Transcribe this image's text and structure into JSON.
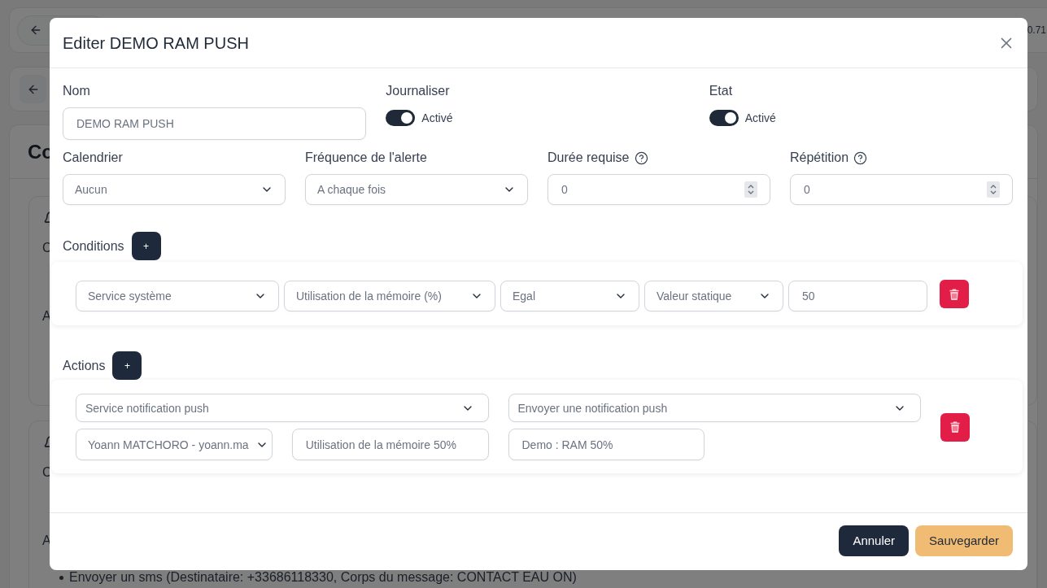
{
  "background": {
    "version": "0.71",
    "section_title": "Co",
    "cards": [
      {
        "lines": [
          "C",
          "A"
        ]
      },
      {
        "lines": [
          "C",
          "A"
        ],
        "bullets": [
          "Envoyer un sms (Destinataire: +33686118330, Corps du message: CONTACT EAU ON)"
        ]
      }
    ]
  },
  "dialog": {
    "title": "Editer DEMO RAM PUSH",
    "name_field": {
      "label": "Nom",
      "value": "DEMO RAM PUSH"
    },
    "toggles": [
      {
        "label": "Journaliser",
        "text": "Activé",
        "on": true
      },
      {
        "label": "Etat",
        "text": "Activé",
        "on": true
      }
    ],
    "settings": [
      {
        "label": "Calendrier",
        "kind": "select",
        "value": "Aucun",
        "help": false
      },
      {
        "label": "Fréquence de l'alerte",
        "kind": "select",
        "value": "A chaque fois",
        "help": false
      },
      {
        "label": "Durée requise",
        "kind": "number",
        "value": "0",
        "help": true
      },
      {
        "label": "Répétition",
        "kind": "number",
        "value": "0",
        "help": true
      }
    ],
    "conditions": {
      "label": "Conditions",
      "add_button": "+",
      "rows": [
        {
          "fields": [
            {
              "kind": "select",
              "value": "Service système"
            },
            {
              "kind": "select",
              "value": "Utilisation de la mémoire (%)"
            },
            {
              "kind": "select",
              "value": "Egal"
            },
            {
              "kind": "select",
              "value": "Valeur statique"
            },
            {
              "kind": "input",
              "value": "50"
            }
          ]
        }
      ]
    },
    "actions": {
      "label": "Actions",
      "add_button": "+",
      "rows": [
        {
          "service": {
            "kind": "select",
            "value": "Service notification push"
          },
          "action": {
            "kind": "select",
            "value": "Envoyer une notification push"
          },
          "params": [
            {
              "kind": "select",
              "value": "Yoann MATCHORO - yoann.ma"
            },
            {
              "kind": "input",
              "value": "Utilisation de la mémoire 50%"
            },
            {
              "kind": "input",
              "value": "Demo : RAM 50%"
            }
          ]
        }
      ]
    },
    "buttons": [
      {
        "label": "Annuler",
        "kind": "secondary"
      },
      {
        "label": "Sauvegarder",
        "kind": "primary"
      }
    ]
  }
}
